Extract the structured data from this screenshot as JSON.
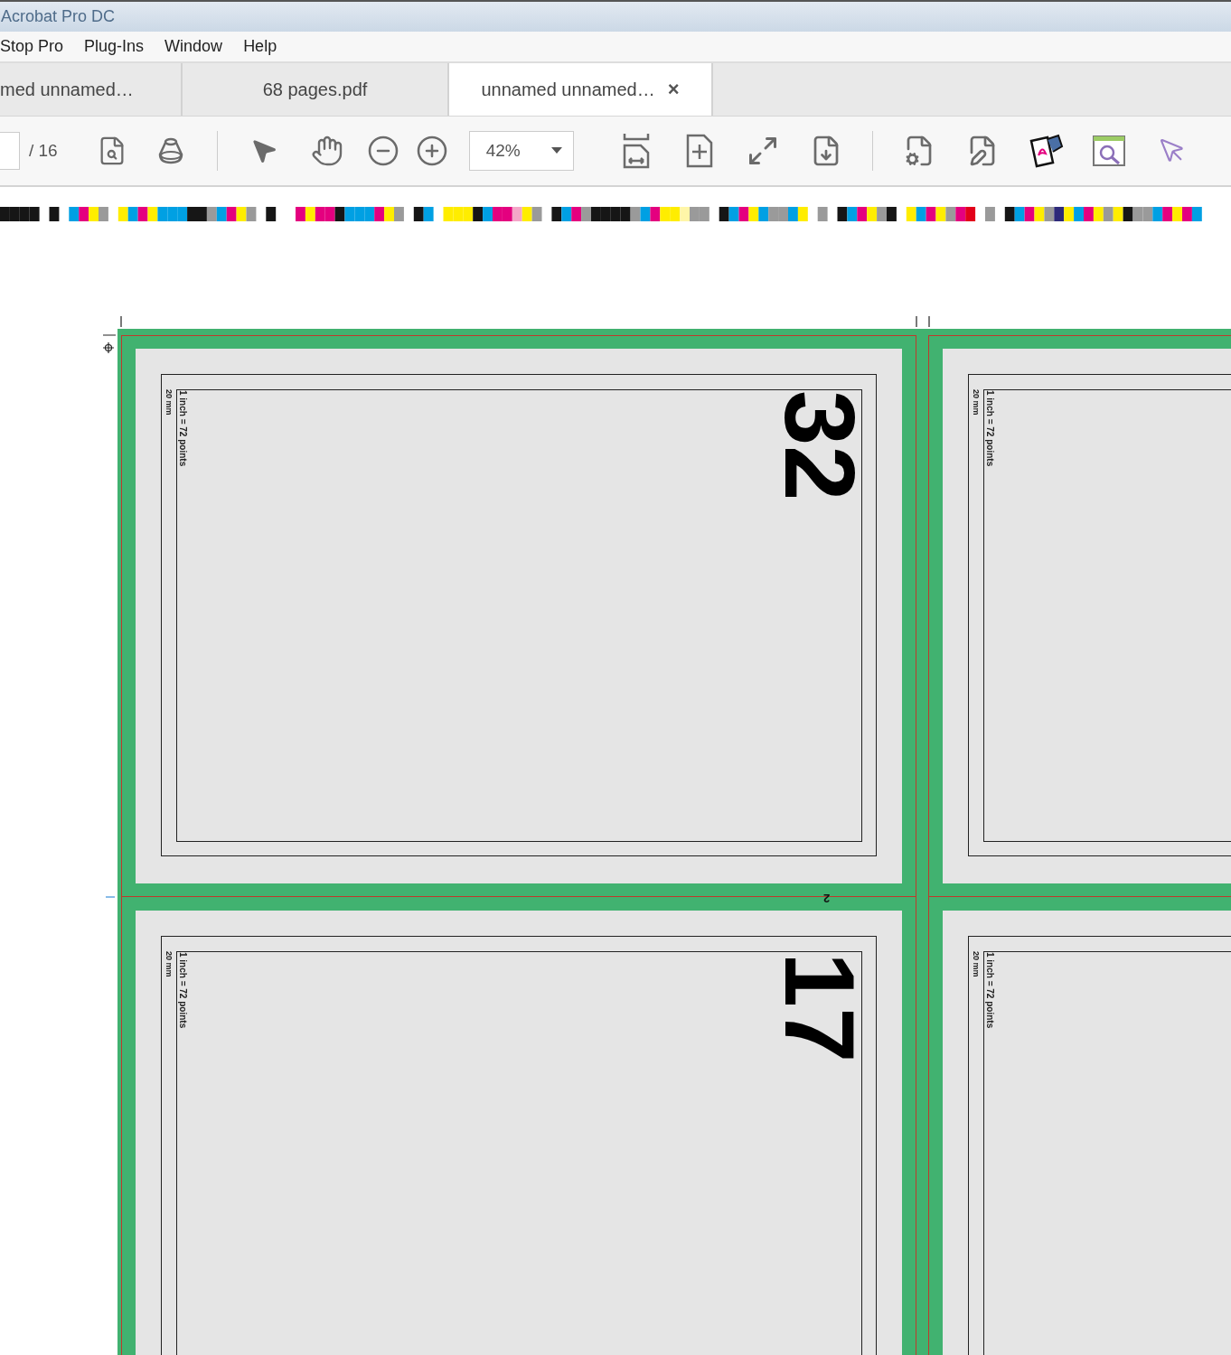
{
  "window": {
    "title": "Acrobat Pro DC"
  },
  "menu": [
    "Stop Pro",
    "Plug-Ins",
    "Window",
    "Help"
  ],
  "tabs": [
    {
      "label": "med unnamed…",
      "selected": false
    },
    {
      "label": "68 pages.pdf",
      "selected": false
    },
    {
      "label": "unnamed unnamed…",
      "selected": true,
      "close": "×"
    }
  ],
  "toolbar": {
    "page_total": "/ 16",
    "zoom": "42%"
  },
  "sheet": {
    "gutter_label": "2",
    "pages": [
      {
        "number": "32",
        "margin_label": "20 mm",
        "scale_label": "1 inch = 72 points"
      },
      {
        "margin_label": "20 mm",
        "scale_label": "1 inch = 72 points"
      },
      {
        "number": "17",
        "margin_label": "20 mm",
        "scale_label": "1 inch = 72 points"
      },
      {
        "margin_label": "20 mm",
        "scale_label": "1 inch = 72 points"
      }
    ]
  }
}
